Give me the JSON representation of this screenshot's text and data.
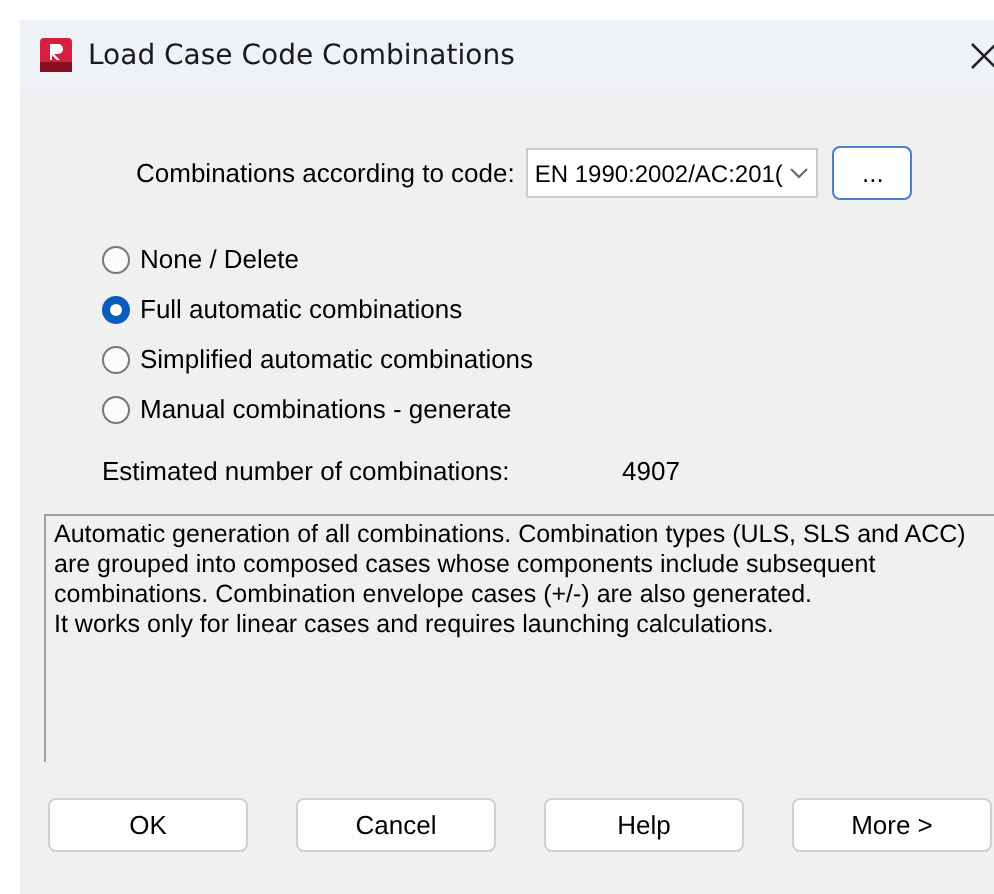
{
  "window": {
    "title": "Load Case Code Combinations"
  },
  "code": {
    "label": "Combinations according to code:",
    "value": "EN 1990:2002/AC:201(",
    "button": "..."
  },
  "options": [
    {
      "label": "None / Delete",
      "selected": false
    },
    {
      "label": "Full automatic combinations",
      "selected": true
    },
    {
      "label": "Simplified automatic combinations",
      "selected": false
    },
    {
      "label": "Manual combinations - generate",
      "selected": false
    }
  ],
  "estimate": {
    "label": "Estimated number of combinations:",
    "value": "4907"
  },
  "description": [
    "Automatic generation of all combinations. Combination types (ULS, SLS and ACC) are grouped into composed cases whose components include subsequent combinations. Combination envelope cases (+/-) are also generated.",
    "It works only for linear cases and requires launching calculations."
  ],
  "buttons": [
    "OK",
    "Cancel",
    "Help",
    "More >"
  ]
}
